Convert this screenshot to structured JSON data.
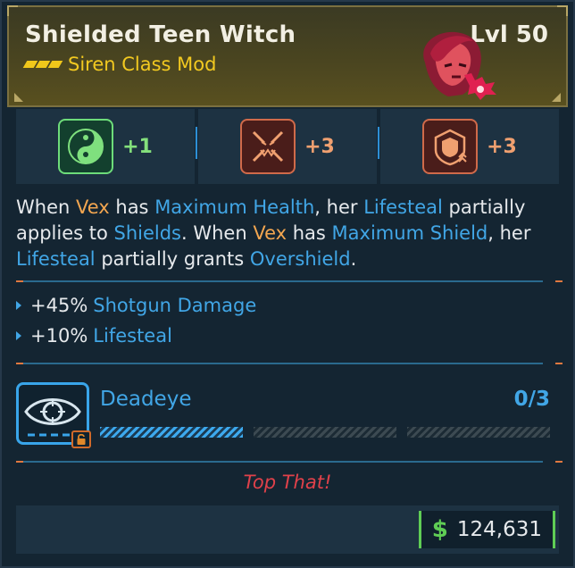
{
  "item": {
    "name": "Shielded Teen Witch",
    "level": "Lvl 50",
    "type": "Siren Class Mod",
    "rarity_color": "#f0c71a"
  },
  "stats": [
    {
      "icon": "yin-yang-icon",
      "value": "+1",
      "color": "#84e07c"
    },
    {
      "icon": "spiked-face-icon",
      "value": "+3",
      "color": "#f0a070"
    },
    {
      "icon": "shield-emblem-icon",
      "value": "+3",
      "color": "#f0a070"
    }
  ],
  "description": {
    "s1": "When ",
    "k1": "Vex",
    "s2": " has ",
    "k2": "Maximum Health",
    "s3": ", her ",
    "k3": "Lifesteal",
    "s4": " partially applies to ",
    "k4": "Shields",
    "s5": ". When ",
    "k5": "Vex",
    "s6": " has ",
    "k6": "Maximum Shield",
    "s7": ", her ",
    "k7": "Lifesteal",
    "s8": " partially grants ",
    "k8": "Overshield",
    "s9": "."
  },
  "bonuses": [
    {
      "value": "+45%",
      "label": "Shotgun Damage"
    },
    {
      "value": "+10%",
      "label": "Lifesteal"
    }
  ],
  "skill": {
    "name": "Deadeye",
    "count": "0/3",
    "progress": 0.333,
    "icon": "eye-crosshair-icon",
    "locked": true
  },
  "flavor_text": "Top That!",
  "price": {
    "currency_symbol": "$",
    "amount": "124,631"
  },
  "colors": {
    "keyword_orange": "#f3a650",
    "keyword_blue": "#41a6e6",
    "flavor_red": "#e0414a",
    "price_green": "#5fcd55"
  }
}
